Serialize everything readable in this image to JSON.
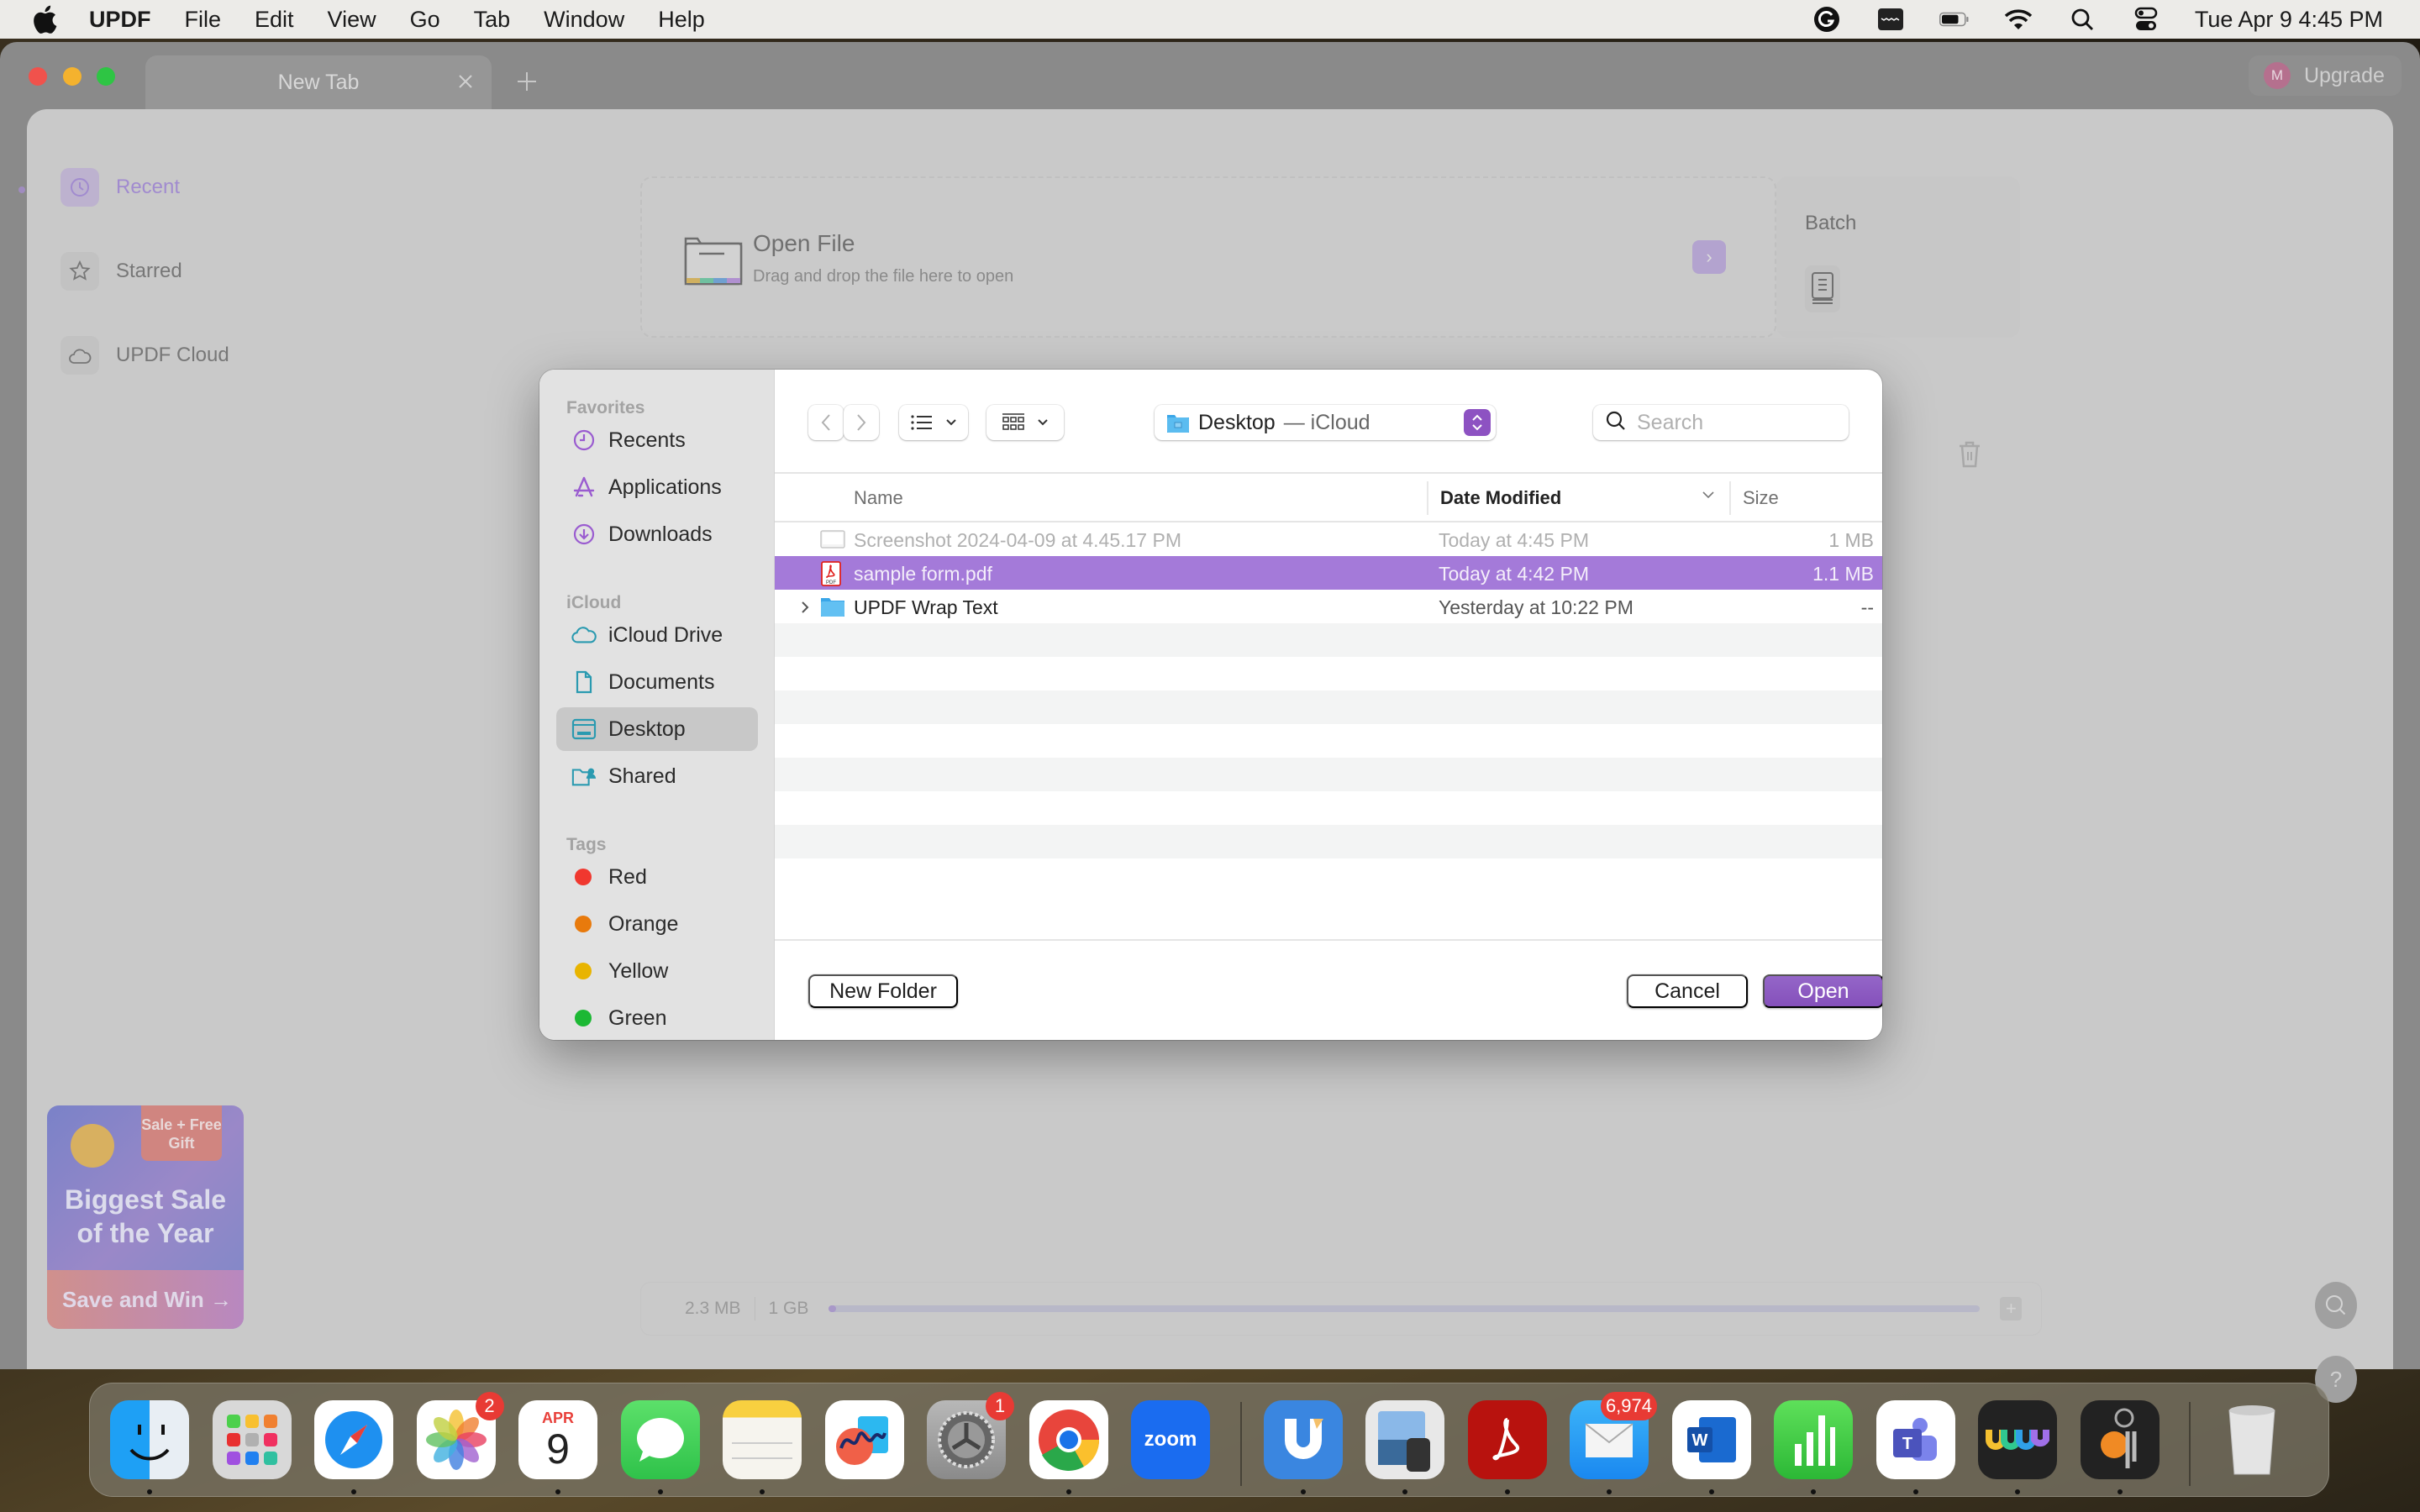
{
  "menubar": {
    "app_name": "UPDF",
    "items": [
      "File",
      "Edit",
      "View",
      "Go",
      "Tab",
      "Window",
      "Help"
    ],
    "status_icons": [
      "grammarly-icon",
      "keyboard-icon",
      "battery-icon",
      "wifi-icon",
      "spotlight-search-icon",
      "control-center-icon"
    ],
    "clock": "Tue Apr 9  4:45 PM"
  },
  "window": {
    "tab_title": "New Tab",
    "upgrade": {
      "avatar_initial": "M",
      "label": "Upgrade"
    }
  },
  "app": {
    "nav": [
      {
        "label": "Recent",
        "icon": "clock-icon",
        "active": true
      },
      {
        "label": "Starred",
        "icon": "star-icon",
        "active": false
      },
      {
        "label": "UPDF Cloud",
        "icon": "cloud-icon",
        "active": false
      }
    ],
    "open_file": {
      "title": "Open File",
      "subtitle": "Drag and drop the file here to open"
    },
    "batch": {
      "title": "Batch"
    },
    "promo": {
      "badge": "Sale + Free Gift",
      "title_line1": "Biggest Sale",
      "title_line2": "of the Year",
      "cta": "Save and Win →"
    },
    "storage": {
      "used": "2.3 MB",
      "total": "1 GB",
      "used_fraction": 0.0023
    }
  },
  "dialog": {
    "sidebar": {
      "sections": [
        {
          "title": "Favorites",
          "items": [
            {
              "label": "Recents",
              "icon": "clock-icon"
            },
            {
              "label": "Applications",
              "icon": "applications-icon"
            },
            {
              "label": "Downloads",
              "icon": "download-icon"
            }
          ]
        },
        {
          "title": "iCloud",
          "items": [
            {
              "label": "iCloud Drive",
              "icon": "cloud-icon"
            },
            {
              "label": "Documents",
              "icon": "document-icon"
            },
            {
              "label": "Desktop",
              "icon": "desktop-icon",
              "selected": true
            },
            {
              "label": "Shared",
              "icon": "shared-folder-icon"
            }
          ]
        },
        {
          "title": "Tags",
          "items": [
            {
              "label": "Red",
              "color": "#f0382f"
            },
            {
              "label": "Orange",
              "color": "#e87a0c"
            },
            {
              "label": "Yellow",
              "color": "#e8b400"
            },
            {
              "label": "Green",
              "color": "#1cb834"
            }
          ]
        }
      ]
    },
    "toolbar": {
      "location": "Desktop",
      "location_suffix": "— iCloud",
      "search_placeholder": "Search",
      "search_value": ""
    },
    "columns": {
      "name": "Name",
      "date": "Date Modified",
      "size": "Size"
    },
    "files": [
      {
        "name": "Screenshot 2024-04-09 at 4.45.17 PM",
        "date": "Today at 4:45 PM",
        "size": "1 MB",
        "type": "image",
        "state": "dimmed"
      },
      {
        "name": "sample form.pdf",
        "date": "Today at 4:42 PM",
        "size": "1.1 MB",
        "type": "pdf",
        "state": "selected"
      },
      {
        "name": "UPDF Wrap Text",
        "date": "Yesterday at 10:22 PM",
        "size": "--",
        "type": "folder",
        "state": "normal"
      }
    ],
    "buttons": {
      "new_folder": "New Folder",
      "cancel": "Cancel",
      "open": "Open"
    }
  },
  "dock": {
    "apps": [
      {
        "name": "Finder",
        "running": true
      },
      {
        "name": "Launchpad",
        "running": false
      },
      {
        "name": "Safari",
        "running": true
      },
      {
        "name": "Photos",
        "running": false,
        "badge": "2"
      },
      {
        "name": "Calendar",
        "running": true,
        "month": "APR",
        "day": "9"
      },
      {
        "name": "Messages",
        "running": true
      },
      {
        "name": "Notes",
        "running": true
      },
      {
        "name": "Freeform",
        "running": false
      },
      {
        "name": "System Settings",
        "running": false,
        "badge": "1"
      },
      {
        "name": "Chrome",
        "running": true
      },
      {
        "name": "Zoom",
        "running": false,
        "label": "zoom"
      },
      {
        "name": "UPDF",
        "running": true
      },
      {
        "name": "Preview",
        "running": true
      },
      {
        "name": "Acrobat",
        "running": true
      },
      {
        "name": "Mail",
        "running": true,
        "badge": "6,974"
      },
      {
        "name": "Word",
        "running": true
      },
      {
        "name": "Numbers",
        "running": true
      },
      {
        "name": "Teams",
        "running": true
      },
      {
        "name": "Wavebox",
        "running": true
      },
      {
        "name": "Keychain Access",
        "running": true
      },
      {
        "name": "Trash",
        "running": false
      }
    ]
  },
  "colors": {
    "accent": "#8d52c2",
    "selection": "#a47ad9",
    "updf_accent": "#a18bcf"
  }
}
